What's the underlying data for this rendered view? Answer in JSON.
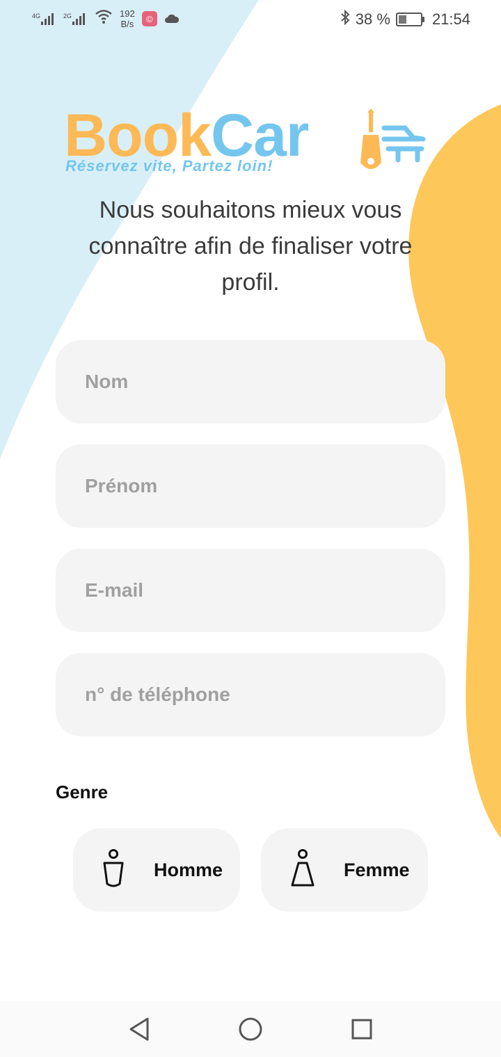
{
  "status_bar": {
    "signal_1": "4G",
    "signal_2": "2G",
    "net_speed_value": "192",
    "net_speed_unit": "B/s",
    "battery_percent": "38 %",
    "battery_level": 0.38,
    "time": "21:54"
  },
  "logo": {
    "part1": "Book",
    "part2": "Car",
    "tagline": "Réservez vite, Partez loin!"
  },
  "intro": {
    "text": "Nous souhaitons mieux vous connaître afin de finaliser votre profil."
  },
  "form": {
    "nom_placeholder": "Nom",
    "prenom_placeholder": "Prénom",
    "email_placeholder": "E-mail",
    "phone_placeholder": "n° de téléphone",
    "genre_label": "Genre",
    "male_label": "Homme",
    "female_label": "Femme"
  },
  "colors": {
    "brand_orange": "#fdb955",
    "brand_blue": "#74c6ee",
    "blob_yellow": "#fdc75a",
    "blob_blue": "#d9eff8"
  },
  "icons": {
    "male": "male-person-icon",
    "female": "female-person-icon",
    "back": "back-triangle-icon",
    "home": "home-circle-icon",
    "recents": "recents-square-icon"
  }
}
